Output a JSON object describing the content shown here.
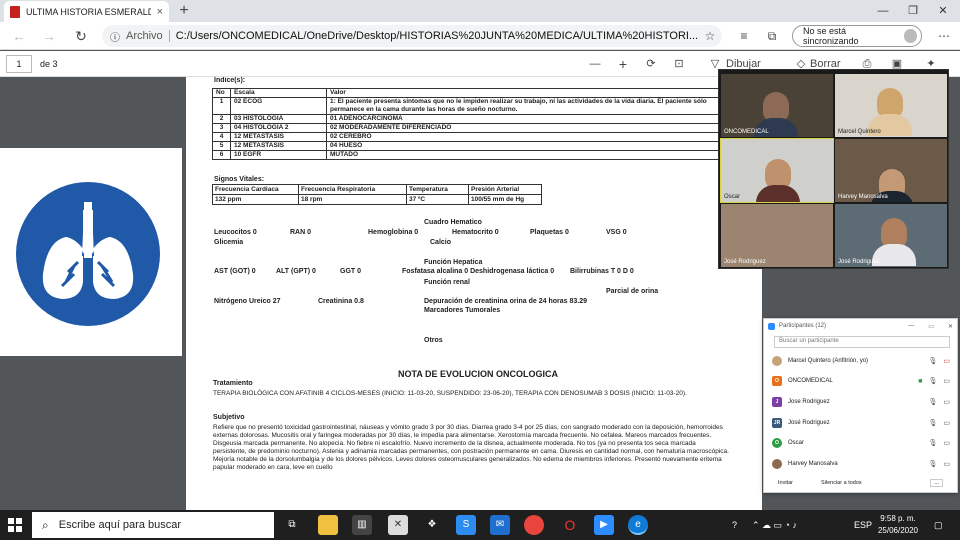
{
  "browser": {
    "tab_title": "ULTIMA HISTORIA ESMERALDA C",
    "tab_close": "×",
    "new_tab": "+",
    "win_min": "—",
    "win_max": "❐",
    "win_close": "✕",
    "address_label": "Archivo",
    "url": "C:/Users/ONCOMEDICAL/OneDrive/Desktop/HISTORIAS%20JUNTA%20MEDICA/ULTIMA%20HISTORI...",
    "sync_label": "No se está sincronizando"
  },
  "pdf_toolbar": {
    "page": "1",
    "of_pages": "de 3",
    "draw_label": "Dibujar",
    "erase_label": "Borrar"
  },
  "document": {
    "index_heading": "Indice(s):",
    "index_headers": [
      "No",
      "Escala",
      "Valor"
    ],
    "index_rows": [
      [
        "1",
        "02 ECOG",
        "1: El paciente presenta síntomas que no le impiden realizar su trabajo, ni las actividades de la vida diaria. El paciente sólo permanece en la cama durante las horas de sueño nocturno."
      ],
      [
        "2",
        "03 HISTOLOGIA",
        "01 ADENOCARCINOMA"
      ],
      [
        "3",
        "04 HISTOLOGIA 2",
        "02 MODERADAMENTE DIFERENCIADO"
      ],
      [
        "4",
        "12 METASTASIS",
        "02 CEREBRO"
      ],
      [
        "5",
        "12 METASTASIS",
        "04 HUESO"
      ],
      [
        "6",
        "10 EGFR",
        "MUTADO"
      ]
    ],
    "vitals_heading": "Signos Vitales:",
    "vitals_headers": [
      "Frecuencia Cardiaca",
      "Frecuencia Respiratoria",
      "Temperatura",
      "Presión Arterial"
    ],
    "vitals_values": [
      "132 ppm",
      "18 rpm",
      "37 ºC",
      "100/55 mm de Hg"
    ],
    "hemo_title": "Cuadro Hematico",
    "hemo": [
      "Leucocitos 0",
      "RAN 0",
      "Hemoglobina 0",
      "Hematocrito 0",
      "Plaquetas 0",
      "VSG 0"
    ],
    "glicemia": "Glicemia",
    "calcio": "Calcio",
    "hepatic_title": "Función Hepatica",
    "hepatic": [
      "AST (GOT) 0",
      "ALT (GPT) 0",
      "GGT 0",
      "Fosfatasa alcalina 0 Deshidrogenasa láctica 0",
      "Bilirrubinas T 0  D 0"
    ],
    "renal_title": "Función renal",
    "parcial": "Parcial de orina",
    "renal": [
      "Nitrógeno Ureico 27",
      "Creatinina 0.8",
      "Depuración de creatinina orina de 24 horas 83.29"
    ],
    "tumor": "Marcadores Tumorales",
    "otros": "Otros",
    "note_title": "NOTA DE EVOLUCION ONCOLOGICA",
    "treatment_heading": "Tratamiento",
    "treatment_text": "TERAPIA BIOLÓGICA CON AFATINIB 4 CICLOS-MESES (INICIO: 11-03-20, SUSPENDIDO: 23-06-20), TERAPIA CON DENOSUMAB 3 DOSIS (INICIO: 11-03-20).",
    "subjective_heading": "Subjetivo",
    "subjective_text": "Refiere que no presentó toxicidad gastrointestinal, náuseas y vómito grado 3 por 30 días. Diarrea grado 3-4 por 25 días, con sangrado moderado con la deposición, hemorroides externas dolorosas. Mucositis oral y faringea moderadas por 30 días, le impedía para alimentarse. Xerostomía marcada frecuente. No cefalea. Mareos marcados frecuentes. Disgeusia marcada permanente. No alopecia. No fiebre ni escalofrío. Nuevo incremento de la disnea, actualmente moderada. No tos (ya no presenta tos seca marcada persistente, de predominio nocturno). Astenia y adinamia marcadas permanentes, con postración permanente en cama. Diuresis en cantidad normal, con hematuria macroscópica. Mejoría notable de la dorsolumbalgia y de los dolores pélvicos. Leves dolores osteomusculares generalizados. No edema de miembros inferiores. Presentó nuevamente eritema papular moderado en cara, leve en cuello"
  },
  "video": {
    "tiles": [
      "ONCOMEDICAL",
      "Marcel Quintero",
      "Oscar",
      "Harvey Manosalva",
      "José Rodriguez",
      "José Rodriguez"
    ]
  },
  "participants": {
    "title": "Participantes (12)",
    "search_placeholder": "Buscar un participante",
    "rows": [
      {
        "name": "Marcel Quintero (Anfitrión, yo)",
        "initial": "",
        "color": "#c8a27a"
      },
      {
        "name": "ONCOMEDICAL",
        "initial": "O",
        "color": "#e8711c"
      },
      {
        "name": "Jose Rodriguez",
        "initial": "J",
        "color": "#7b3fa6"
      },
      {
        "name": "José Rodriguez",
        "initial": "JR",
        "color": "#3b5a7a"
      },
      {
        "name": "Oscar",
        "initial": "O",
        "color": "#2e9e44"
      },
      {
        "name": "Harvey Manosalva",
        "initial": "",
        "color": "#8a6a50"
      }
    ],
    "invite": "Invitar",
    "mute_all": "Silenciar a todos",
    "more": "..."
  },
  "taskbar": {
    "search_text": "Escribe aquí para buscar",
    "lang": "ESP",
    "time": "9:58 p. m.",
    "date": "25/06/2020"
  }
}
